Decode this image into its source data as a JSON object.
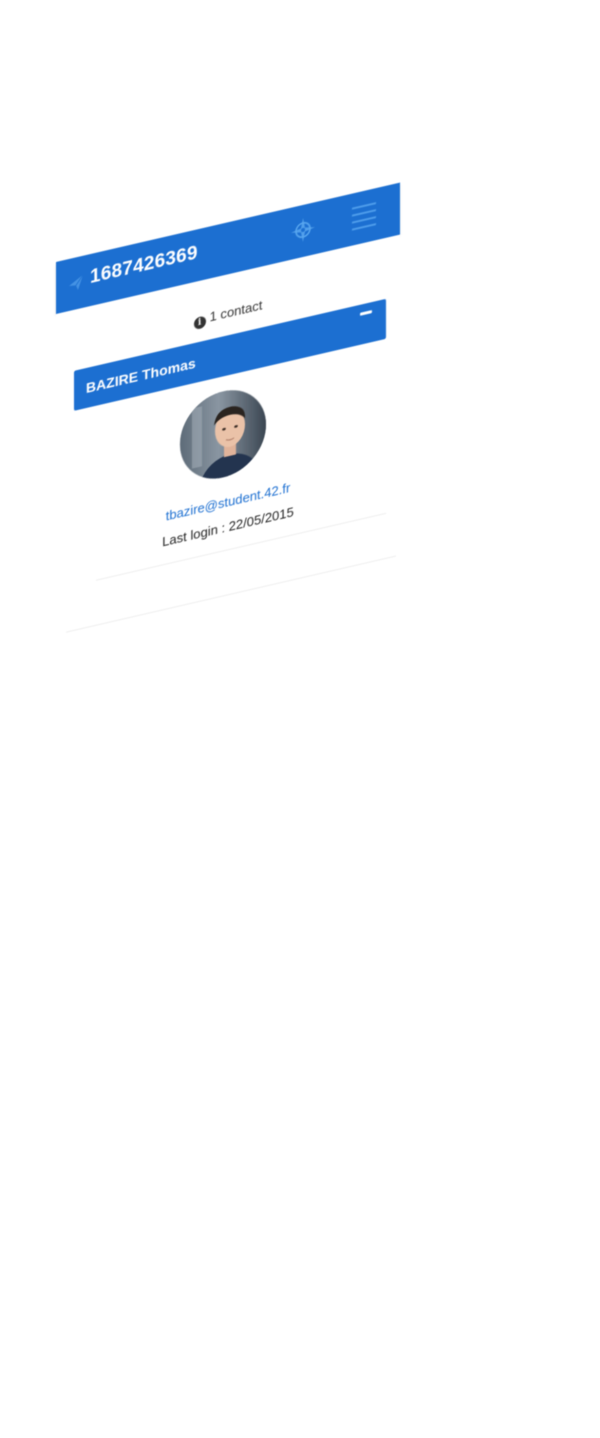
{
  "header": {
    "title": "1687426369",
    "nav_icon": "send-icon",
    "compass_icon": "compass-icon",
    "menu_icon": "hamburger-menu-icon"
  },
  "summary": {
    "contact_count_text": "1 contact",
    "info_icon": "info-icon"
  },
  "contact": {
    "name": "BAZIRE Thomas",
    "collapse_icon": "minus-icon",
    "avatar": "user-photo",
    "email": "tbazire@student.42.fr",
    "last_login": "Last login : 22/05/2015"
  },
  "colors": {
    "primary": "#1c6fd1",
    "text": "#222222",
    "background": "#ffffff"
  }
}
